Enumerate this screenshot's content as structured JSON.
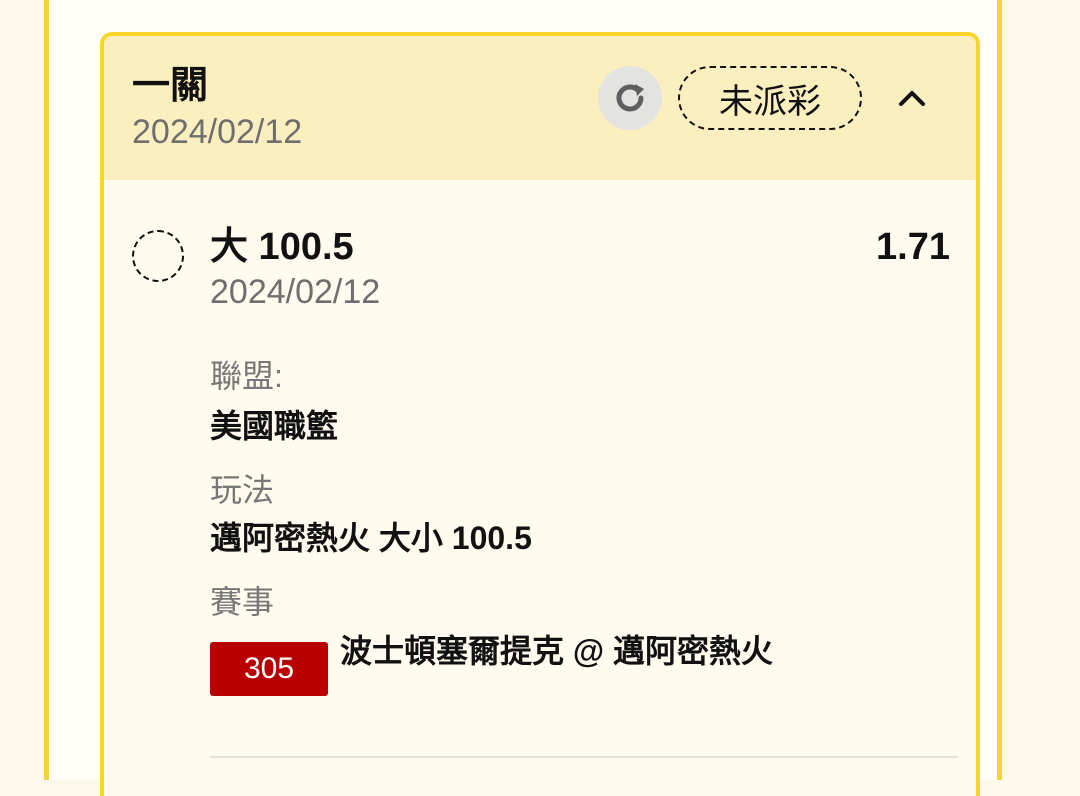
{
  "bet_card": {
    "bet_type": "一關",
    "date": "2024/02/12",
    "status": "未派彩",
    "refresh_icon": "refresh-icon",
    "collapse_icon": "chevron-up-icon"
  },
  "selection": {
    "name": "大 100.5",
    "date": "2024/02/12",
    "odds": "1.71",
    "status_icon": "pending-circle-icon"
  },
  "details": {
    "league_label": "聯盟:",
    "league_value": "美國職籃",
    "play_label": "玩法",
    "play_value": "邁阿密熱火 大小 100.5",
    "event_label": "賽事",
    "event_number": "305",
    "event_name": "波士頓塞爾提克 @ 邁阿密熱火"
  },
  "colors": {
    "accent_yellow": "#f7d62a",
    "header_bg": "#fcefbf",
    "badge_red": "#b80000"
  }
}
